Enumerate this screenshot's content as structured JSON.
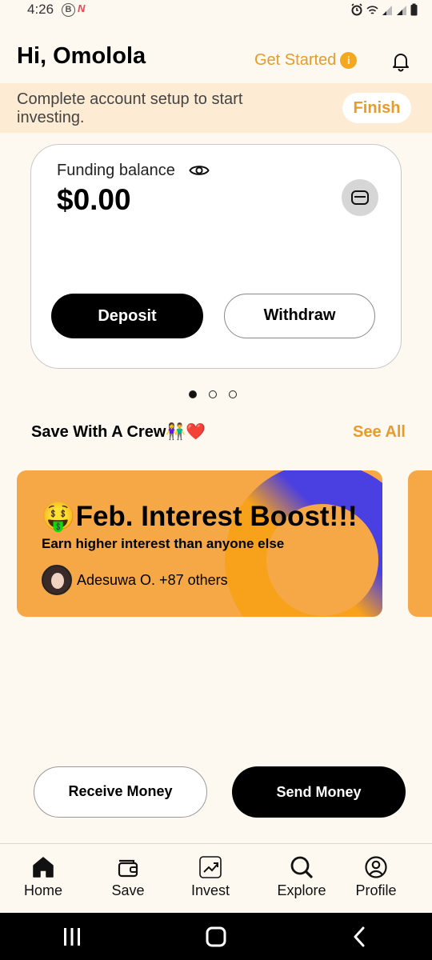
{
  "status_bar": {
    "time": "4:26",
    "b_badge": "B",
    "n_badge": "N"
  },
  "header": {
    "greeting": "Hi, Omolola",
    "get_started_label": "Get Started",
    "info_glyph": "i"
  },
  "setup_banner": {
    "text": "Complete account setup to start investing.",
    "finish_label": "Finish"
  },
  "balance_card": {
    "label": "Funding balance",
    "amount": "$0.00",
    "deposit_label": "Deposit",
    "withdraw_label": "Withdraw"
  },
  "carousel": {
    "total": 3,
    "active_index": 0
  },
  "crew_section": {
    "title": "Save With A Crew👫❤️",
    "see_all_label": "See All"
  },
  "promo_card": {
    "title": "🤑Feb. Interest Boost!!!",
    "subtitle": "Earn higher interest than anyone else",
    "members": "Adesuwa O. +87 others"
  },
  "actions": {
    "receive_label": "Receive Money",
    "send_label": "Send Money"
  },
  "bottom_nav": {
    "items": [
      {
        "label": "Home",
        "icon": "home-icon"
      },
      {
        "label": "Save",
        "icon": "wallet-icon"
      },
      {
        "label": "Invest",
        "icon": "chart-up-icon"
      },
      {
        "label": "Explore",
        "icon": "search-icon"
      },
      {
        "label": "Profile",
        "icon": "profile-icon"
      }
    ]
  },
  "colors": {
    "background": "#fdf8f0",
    "accent": "#e89b2a",
    "banner": "#fdebd3",
    "promo": "#f6a846",
    "promo_ring": "#4a3fe0"
  }
}
